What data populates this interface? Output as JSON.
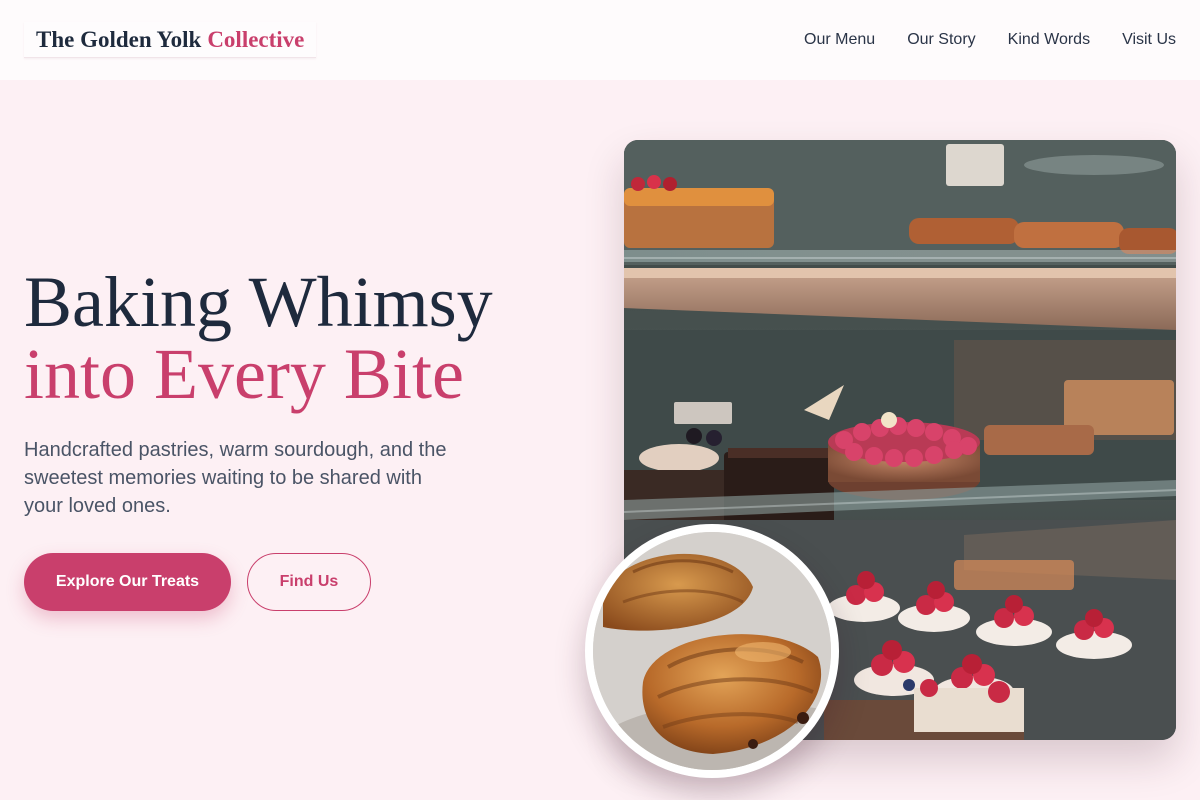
{
  "header": {
    "logo": {
      "main": "The Golden Yolk",
      "accent": "Collective"
    },
    "nav": [
      "Our Menu",
      "Our Story",
      "Kind Words",
      "Visit Us"
    ]
  },
  "hero": {
    "title_line1": "Baking Whimsy",
    "title_line2": "into Every Bite",
    "lead": "Handcrafted pastries, warm sourdough, and the sweetest memories waiting to be shared with your loved ones.",
    "primary_button": "Explore Our Treats",
    "secondary_button": "Find Us"
  },
  "colors": {
    "accent": "#c93f6c",
    "heading": "#1e2a3d",
    "body_text": "#4a5466",
    "background": "#fdf0f4",
    "header_bg": "#fefbfc"
  }
}
